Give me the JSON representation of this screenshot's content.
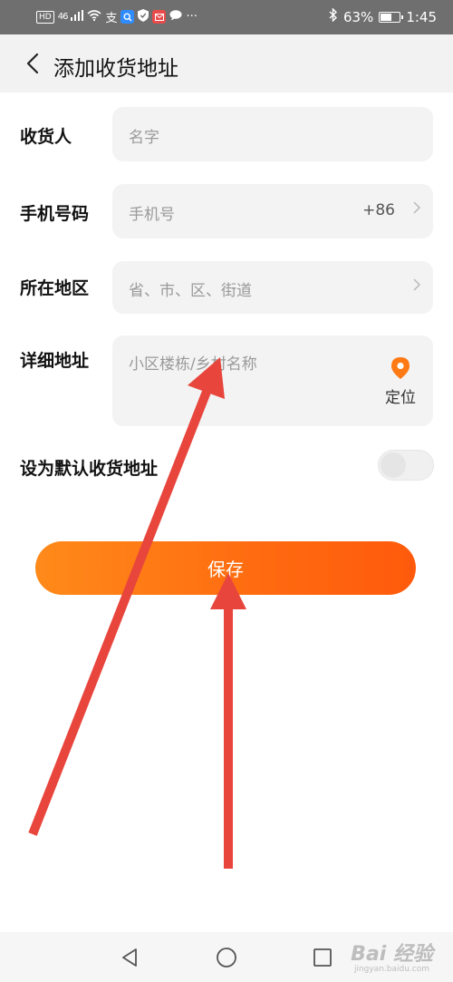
{
  "status_bar": {
    "hd_label": "HD",
    "network": "46",
    "battery_percent": "63%",
    "battery_level": 0.63,
    "time": "1:45",
    "bg_color": "#6f6f6f"
  },
  "header": {
    "title": "添加收货地址",
    "bg_color": "#f2f2f2"
  },
  "form": {
    "recipient": {
      "label": "收货人",
      "placeholder": "名字"
    },
    "phone": {
      "label": "手机号码",
      "placeholder": "手机号",
      "country_code": "+86"
    },
    "region": {
      "label": "所在地区",
      "placeholder": "省、市、区、街道"
    },
    "detail": {
      "label": "详细地址",
      "placeholder": "小区楼栋/乡村名称",
      "locate_label": "定位",
      "locate_icon": "location-pin-icon"
    },
    "default_address": {
      "label": "设为默认收货地址",
      "enabled": false
    }
  },
  "save_button": {
    "label": "保存",
    "color_start": "#ff8a1a",
    "color_end": "#ff5a0c"
  },
  "nav_bar": {
    "icons": [
      "back-triangle-icon",
      "home-circle-icon",
      "recents-square-icon"
    ]
  },
  "watermark": {
    "text": "Bai 经验",
    "sub": "jingyan.baidu.com"
  },
  "annotation_arrow_color": "#e8453c"
}
